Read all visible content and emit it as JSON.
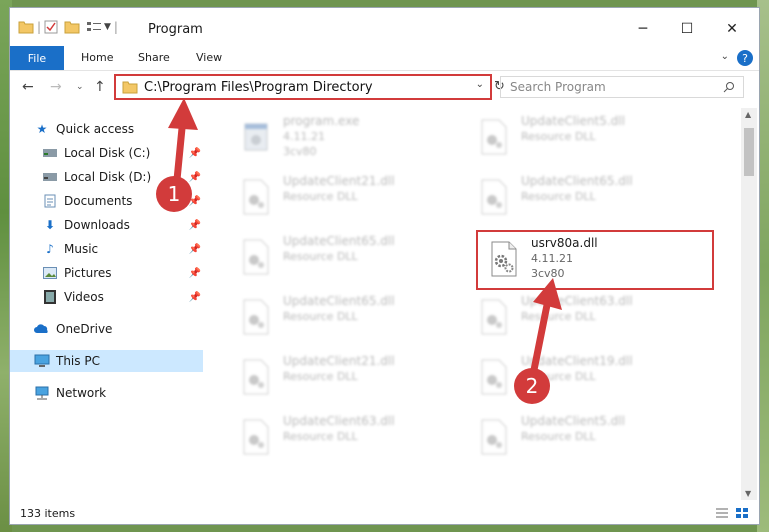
{
  "window": {
    "title": "Program",
    "help": "?"
  },
  "window_controls": {
    "minimize": "─",
    "maximize": "☐",
    "close": "✕"
  },
  "ribbon": {
    "file": "File",
    "tabs": [
      "Home",
      "Share",
      "View"
    ]
  },
  "address": {
    "path": "C:\\Program Files\\Program Directory"
  },
  "search": {
    "placeholder": "Search Program"
  },
  "nav": {
    "quick_access": "Quick access",
    "items": [
      {
        "label": "Local Disk (C:)",
        "icon": "drive-icon"
      },
      {
        "label": "Local Disk (D:)",
        "icon": "drive-icon"
      },
      {
        "label": "Documents",
        "icon": "documents-icon"
      },
      {
        "label": "Downloads",
        "icon": "download-icon"
      },
      {
        "label": "Music",
        "icon": "music-icon"
      },
      {
        "label": "Pictures",
        "icon": "pictures-icon"
      },
      {
        "label": "Videos",
        "icon": "videos-icon"
      }
    ],
    "onedrive": "OneDrive",
    "this_pc": "This PC",
    "network": "Network"
  },
  "files": [
    {
      "name": "program.exe",
      "line2": "4.11.21",
      "line3": "3cv80",
      "kind": "exe",
      "blur": true
    },
    {
      "name": "UpdateClient5.dll",
      "line2": "Resource DLL",
      "line3": "",
      "kind": "dll",
      "blur": true
    },
    {
      "name": "UpdateClient21.dll",
      "line2": "Resource DLL",
      "line3": "",
      "kind": "dll",
      "blur": true
    },
    {
      "name": "UpdateClient65.dll",
      "line2": "Resource DLL",
      "line3": "",
      "kind": "dll",
      "blur": true
    },
    {
      "name": "UpdateClient65.dll",
      "line2": "Resource DLL",
      "line3": "",
      "kind": "dll",
      "blur": true
    },
    {
      "name": "usrv80a.dll",
      "line2": "4.11.21",
      "line3": "3cv80",
      "kind": "dll",
      "blur": false
    },
    {
      "name": "UpdateClient65.dll",
      "line2": "Resource DLL",
      "line3": "",
      "kind": "dll",
      "blur": true
    },
    {
      "name": "UpdateClient63.dll",
      "line2": "Resource DLL",
      "line3": "",
      "kind": "dll",
      "blur": true
    },
    {
      "name": "UpdateClient21.dll",
      "line2": "Resource DLL",
      "line3": "",
      "kind": "dll",
      "blur": true
    },
    {
      "name": "UpdateClient19.dll",
      "line2": "Resource DLL",
      "line3": "",
      "kind": "dll",
      "blur": true
    },
    {
      "name": "UpdateClient63.dll",
      "line2": "Resource DLL",
      "line3": "",
      "kind": "dll",
      "blur": true
    },
    {
      "name": "UpdateClient5.dll",
      "line2": "Resource DLL",
      "line3": "",
      "kind": "dll",
      "blur": true
    }
  ],
  "status": {
    "count": "133 items"
  },
  "callouts": [
    "1",
    "2"
  ],
  "colors": {
    "accent": "#1a6fc8",
    "highlight": "#d23b3b",
    "selected_nav": "#cce8ff"
  }
}
